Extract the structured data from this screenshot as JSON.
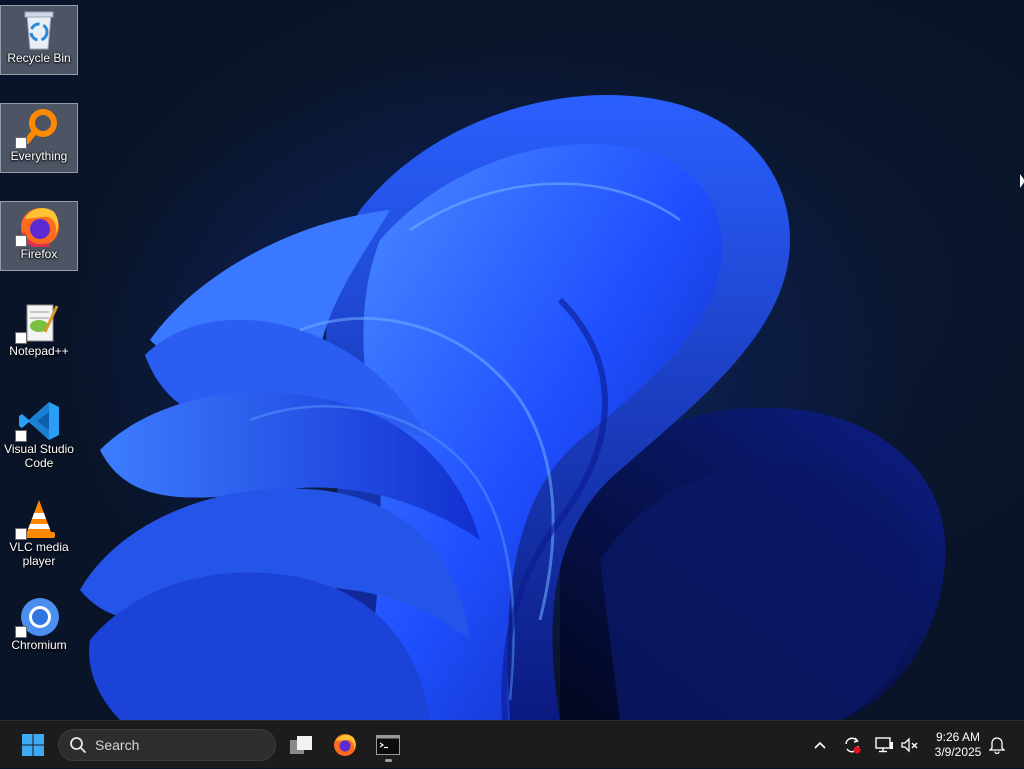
{
  "desktop": {
    "icons": [
      {
        "label": "Recycle Bin",
        "icon": "recycle-bin-icon",
        "selected": true
      },
      {
        "label": "Everything",
        "icon": "everything-search-icon",
        "selected": true
      },
      {
        "label": "Firefox",
        "icon": "firefox-icon",
        "selected": true
      },
      {
        "label": "Notepad++",
        "icon": "notepad-plus-plus-icon",
        "selected": false
      },
      {
        "label": "Visual Studio\nCode",
        "icon": "vscode-icon",
        "selected": false
      },
      {
        "label": "VLC media\nplayer",
        "icon": "vlc-icon",
        "selected": false
      },
      {
        "label": "Chromium",
        "icon": "chromium-icon",
        "selected": false
      }
    ]
  },
  "taskbar": {
    "search_placeholder": "Search",
    "pinned": [
      "start-button",
      "task-view-button",
      "firefox-taskbar-button",
      "terminal-taskbar-button"
    ],
    "clock": {
      "time": "9:26 AM",
      "date": "3/9/2025"
    }
  },
  "colors": {
    "taskbar_bg": "#1c1c1c",
    "accent": "#0078d4",
    "wallpaper_blue": "#1f4fff"
  }
}
